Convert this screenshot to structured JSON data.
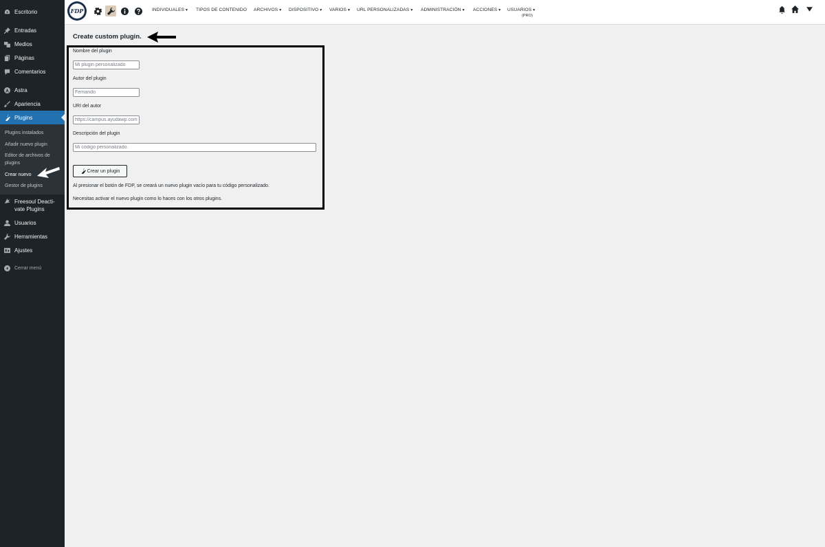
{
  "sidebar": {
    "items": [
      {
        "label": "Escritorio",
        "icon": "dashboard-icon"
      },
      {
        "label": "Entradas",
        "icon": "pin-icon"
      },
      {
        "label": "Medios",
        "icon": "media-icon"
      },
      {
        "label": "Páginas",
        "icon": "pages-icon"
      },
      {
        "label": "Comentarios",
        "icon": "comment-icon"
      },
      {
        "label": "Astra",
        "icon": "astra-icon"
      },
      {
        "label": "Apariencia",
        "icon": "brush-icon"
      },
      {
        "label": "Plugins",
        "icon": "plugin-icon"
      },
      {
        "label": "Freesoul Deacti-vate Plugins",
        "icon": "freesoul-icon"
      },
      {
        "label": "Usuarios",
        "icon": "user-icon"
      },
      {
        "label": "Herramientas",
        "icon": "wrench-icon"
      },
      {
        "label": "Ajustes",
        "icon": "settings-icon"
      }
    ],
    "submenu": [
      {
        "label": "Plugins instalados"
      },
      {
        "label": "Añadir nuevo plugin"
      },
      {
        "label": "Editor de archivos de plugins"
      },
      {
        "label": "Crear nuevo"
      },
      {
        "label": "Gestor de plugins"
      }
    ],
    "collapse_label": "Cerrar menú"
  },
  "topbar": {
    "logo_text": "FDP",
    "nav": [
      {
        "label": "INDIVIDUALES"
      },
      {
        "label": "TIPOS DE CONTENIDO"
      },
      {
        "label": "ARCHIVOS"
      },
      {
        "label": "DISPOSITIVO"
      },
      {
        "label": "VARIOS"
      },
      {
        "label": "URL PERSONALIZADAS"
      },
      {
        "label": "ADMINISTRACIÓN"
      },
      {
        "label": "ACCIONES"
      },
      {
        "label": "USUARIOS"
      }
    ],
    "pro_label": "(PRO)",
    "caret": "▼"
  },
  "main": {
    "title": "Create custom plugin.",
    "fields": [
      {
        "label": "Nombre del plugin",
        "placeholder": "Mi plugin personalizado",
        "value": ""
      },
      {
        "label": "Autor del plugin",
        "placeholder": "Fernando",
        "value": ""
      },
      {
        "label": "URI del autor",
        "placeholder": "https://campus.ayudawp.com",
        "value": ""
      },
      {
        "label": "Descripción del plugin",
        "placeholder": "Mi código personalizado.",
        "value": ""
      }
    ],
    "button_label": "Crear un plugin",
    "note1": "Al presionar el botón de FDP, se creará un nuevo plugin vacío para tu código personalizado.",
    "note2": "Necesitas activar el nuevo plugin como lo haces con los otros plugins."
  },
  "colors": {
    "sidebar_bg": "#1d2327",
    "active_bg": "#2271b1",
    "page_bg": "#f0f0f1"
  }
}
